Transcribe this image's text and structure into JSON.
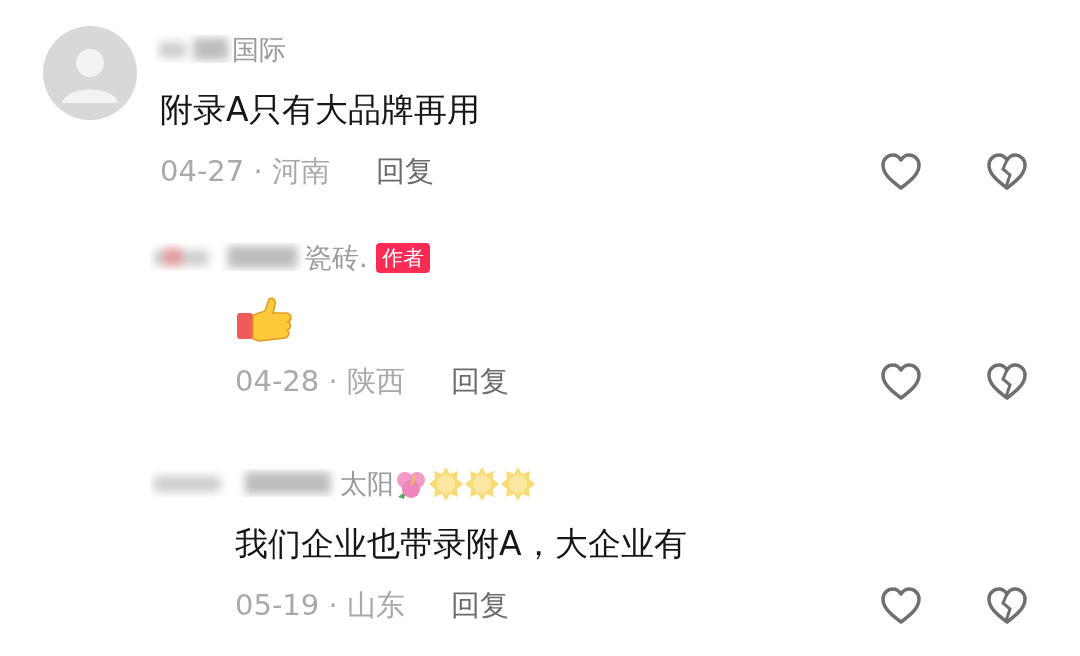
{
  "comments": [
    {
      "kind": "top",
      "name": "国际",
      "body": {
        "kind": "text",
        "text": "附录A只有大品牌再用"
      },
      "meta": "04-27 · 河南",
      "reply": "回复"
    },
    {
      "kind": "reply",
      "name": "瓷砖.",
      "badge": "作者",
      "body": {
        "kind": "emoji"
      },
      "meta": "04-28 · 陕西",
      "reply": "回复"
    },
    {
      "kind": "reply",
      "name": "太阳",
      "name_icons": [
        {
          "kind": "flower"
        },
        {
          "kind": "sun"
        },
        {
          "kind": "sun"
        },
        {
          "kind": "sun"
        }
      ],
      "body": {
        "kind": "text",
        "text": "我们企业也带录附A，大企业有"
      },
      "meta": "05-19 · 山东",
      "reply": "回复"
    }
  ]
}
